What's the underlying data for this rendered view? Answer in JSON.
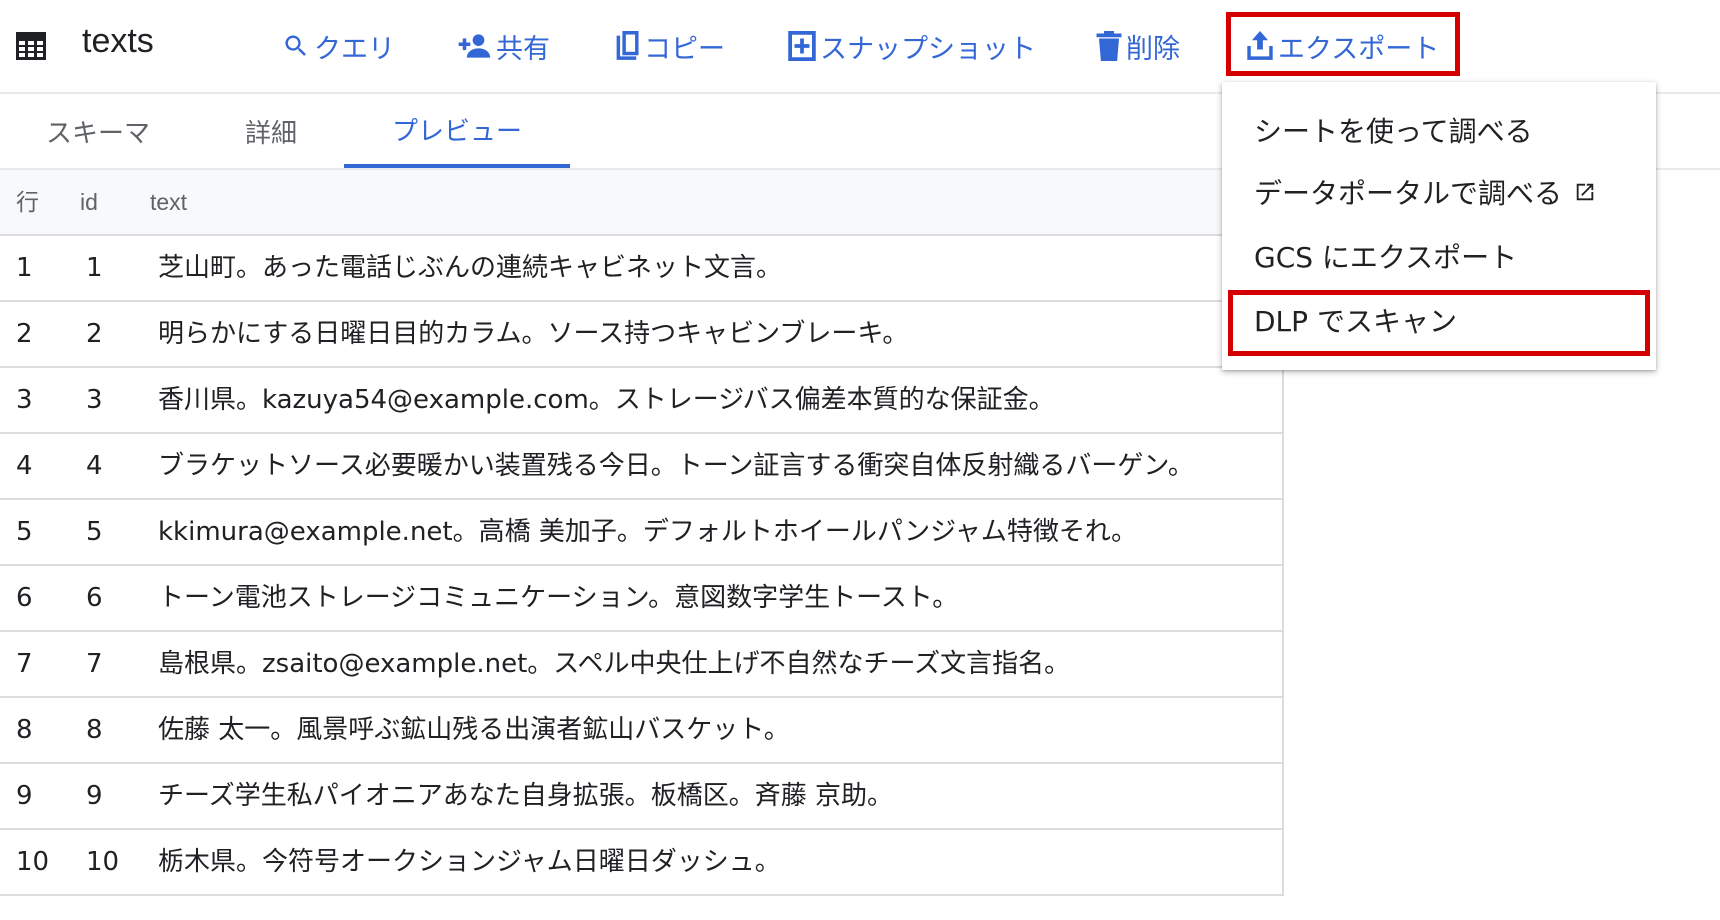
{
  "header": {
    "title": "texts",
    "actions": {
      "query": "クエリ",
      "share": "共有",
      "copy": "コピー",
      "snapshot": "スナップショット",
      "delete": "削除",
      "export": "エクスポート"
    }
  },
  "tabs": [
    {
      "label": "スキーマ"
    },
    {
      "label": "詳細"
    },
    {
      "label": "プレビュー",
      "active": true
    }
  ],
  "table": {
    "columns": [
      "行",
      "id",
      "text"
    ],
    "rows": [
      {
        "row": "1",
        "id": "1",
        "text": "芝山町。あった電話じぶんの連続キャビネット文言。"
      },
      {
        "row": "2",
        "id": "2",
        "text": "明らかにする日曜日目的カラム。ソース持つキャビンブレーキ。"
      },
      {
        "row": "3",
        "id": "3",
        "text": "香川県。kazuya54@example.com。ストレージバス偏差本質的な保証金。"
      },
      {
        "row": "4",
        "id": "4",
        "text": "ブラケットソース必要暖かい装置残る今日。トーン証言する衝突自体反射織るバーゲン。"
      },
      {
        "row": "5",
        "id": "5",
        "text": "kkimura@example.net。高橋 美加子。デフォルトホイールパンジャム特徴それ。"
      },
      {
        "row": "6",
        "id": "6",
        "text": "トーン電池ストレージコミュニケーション。意図数字学生トースト。"
      },
      {
        "row": "7",
        "id": "7",
        "text": "島根県。zsaito@example.net。スペル中央仕上げ不自然なチーズ文言指名。"
      },
      {
        "row": "8",
        "id": "8",
        "text": "佐藤 太一。風景呼ぶ鉱山残る出演者鉱山バスケット。"
      },
      {
        "row": "9",
        "id": "9",
        "text": "チーズ学生私パイオニアあなた自身拡張。板橋区。斉藤 京助。"
      },
      {
        "row": "10",
        "id": "10",
        "text": "栃木県。今符号オークションジャム日曜日ダッシュ。"
      }
    ]
  },
  "export_menu": {
    "items": [
      {
        "label": "シートを使って調べる"
      },
      {
        "label": "データポータルで調べる",
        "icon": "open-in-new-icon"
      },
      {
        "label": "GCS にエクスポート"
      },
      {
        "label": "DLP でスキャン",
        "highlighted": true
      }
    ]
  },
  "colors": {
    "accent": "#3367d6",
    "highlight_border": "#d40000",
    "text": "#202124",
    "muted": "#5f6368"
  }
}
